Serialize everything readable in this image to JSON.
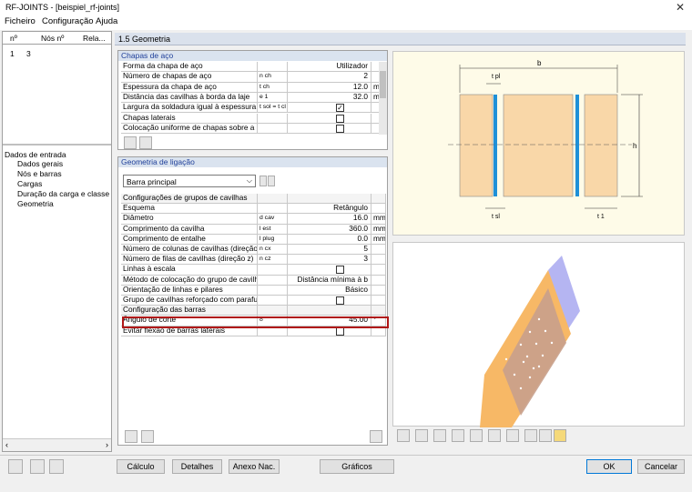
{
  "window": {
    "title": "RF-JOINTS - [beispiel_rf-joints]"
  },
  "menu": [
    "Ficheiro",
    "Configuração",
    "Ajuda"
  ],
  "left": {
    "headers": [
      "nº",
      "Nós nº",
      "Rela..."
    ],
    "row": [
      "1",
      "3"
    ],
    "tree_root": "Dados de entrada",
    "tree_items": [
      "Dados gerais",
      "Nós e barras",
      "Cargas",
      "Duração da carga e classe de u",
      "Geometria"
    ]
  },
  "pane_title": "1.5 Geometria",
  "plates": {
    "title": "Chapas de aço",
    "rows": [
      {
        "label": "Forma da chapa de aço",
        "sym": "",
        "value": "Utilizador",
        "unit": ""
      },
      {
        "label": "Número de chapas de aço",
        "sym": "n ch",
        "value": "2",
        "unit": ""
      },
      {
        "label": "Espessura da chapa de aço",
        "sym": "t ch",
        "value": "12.0",
        "unit": "mm"
      },
      {
        "label": "Distância das cavilhas à borda da laje",
        "sym": "e 1",
        "value": "32.0",
        "unit": "mm"
      },
      {
        "label": "Largura da soldadura igual à espessura",
        "sym": "t sol = t cl",
        "value": "",
        "unit": ""
      },
      {
        "label": "Chapas laterais",
        "sym": "",
        "value": "",
        "unit": ""
      },
      {
        "label": "Colocação uniforme de chapas sobre a",
        "sym": "",
        "value": "",
        "unit": ""
      }
    ]
  },
  "conn": {
    "title": "Geometria de ligação",
    "dropdown": "Barra principal",
    "rows": [
      {
        "label": "Configurações de grupos de cavilhas",
        "sym": "",
        "value": "",
        "unit": ""
      },
      {
        "label": "Esquema",
        "sym": "",
        "value": "Retângulo",
        "unit": ""
      },
      {
        "label": "Diâmetro",
        "sym": "d cav",
        "value": "16.0",
        "unit": "mm"
      },
      {
        "label": "Comprimento da cavilha",
        "sym": "l est",
        "value": "360.0",
        "unit": "mm"
      },
      {
        "label": "Comprimento de entalhe",
        "sym": "l plug",
        "value": "0.0",
        "unit": "mm"
      },
      {
        "label": "Número de colunas de cavilhas (direção x)",
        "sym": "n cx",
        "value": "5",
        "unit": ""
      },
      {
        "label": "Número de filas de cavilhas (direção z)",
        "sym": "n cz",
        "value": "3",
        "unit": ""
      },
      {
        "label": "Linhas à escala",
        "sym": "",
        "value": "",
        "unit": ""
      },
      {
        "label": "Método de colocação do grupo de cavilhas",
        "sym": "",
        "value": "Distância mínima à b",
        "unit": ""
      },
      {
        "label": "Orientação de linhas e pilares",
        "sym": "",
        "value": "Básico",
        "unit": ""
      },
      {
        "label": "Grupo de cavilhas reforçado com parafusos",
        "sym": "",
        "value": "",
        "unit": ""
      },
      {
        "label": "Configuração das barras",
        "sym": "",
        "value": "",
        "unit": ""
      },
      {
        "label": "Ângulo de corte",
        "sym": "δ",
        "value": "45.00",
        "unit": "°"
      },
      {
        "label": "Evitar flexão de barras laterais",
        "sym": "",
        "value": "",
        "unit": ""
      }
    ]
  },
  "drawing": {
    "b": "b",
    "tpl": "t pl",
    "h": "h",
    "tsl": "t sl",
    "t1": "t 1"
  },
  "buttons": {
    "calc": "Cálculo",
    "details": "Detalhes",
    "annex": "Anexo Nac.",
    "graphics": "Gráficos",
    "ok": "OK",
    "cancel": "Cancelar"
  }
}
